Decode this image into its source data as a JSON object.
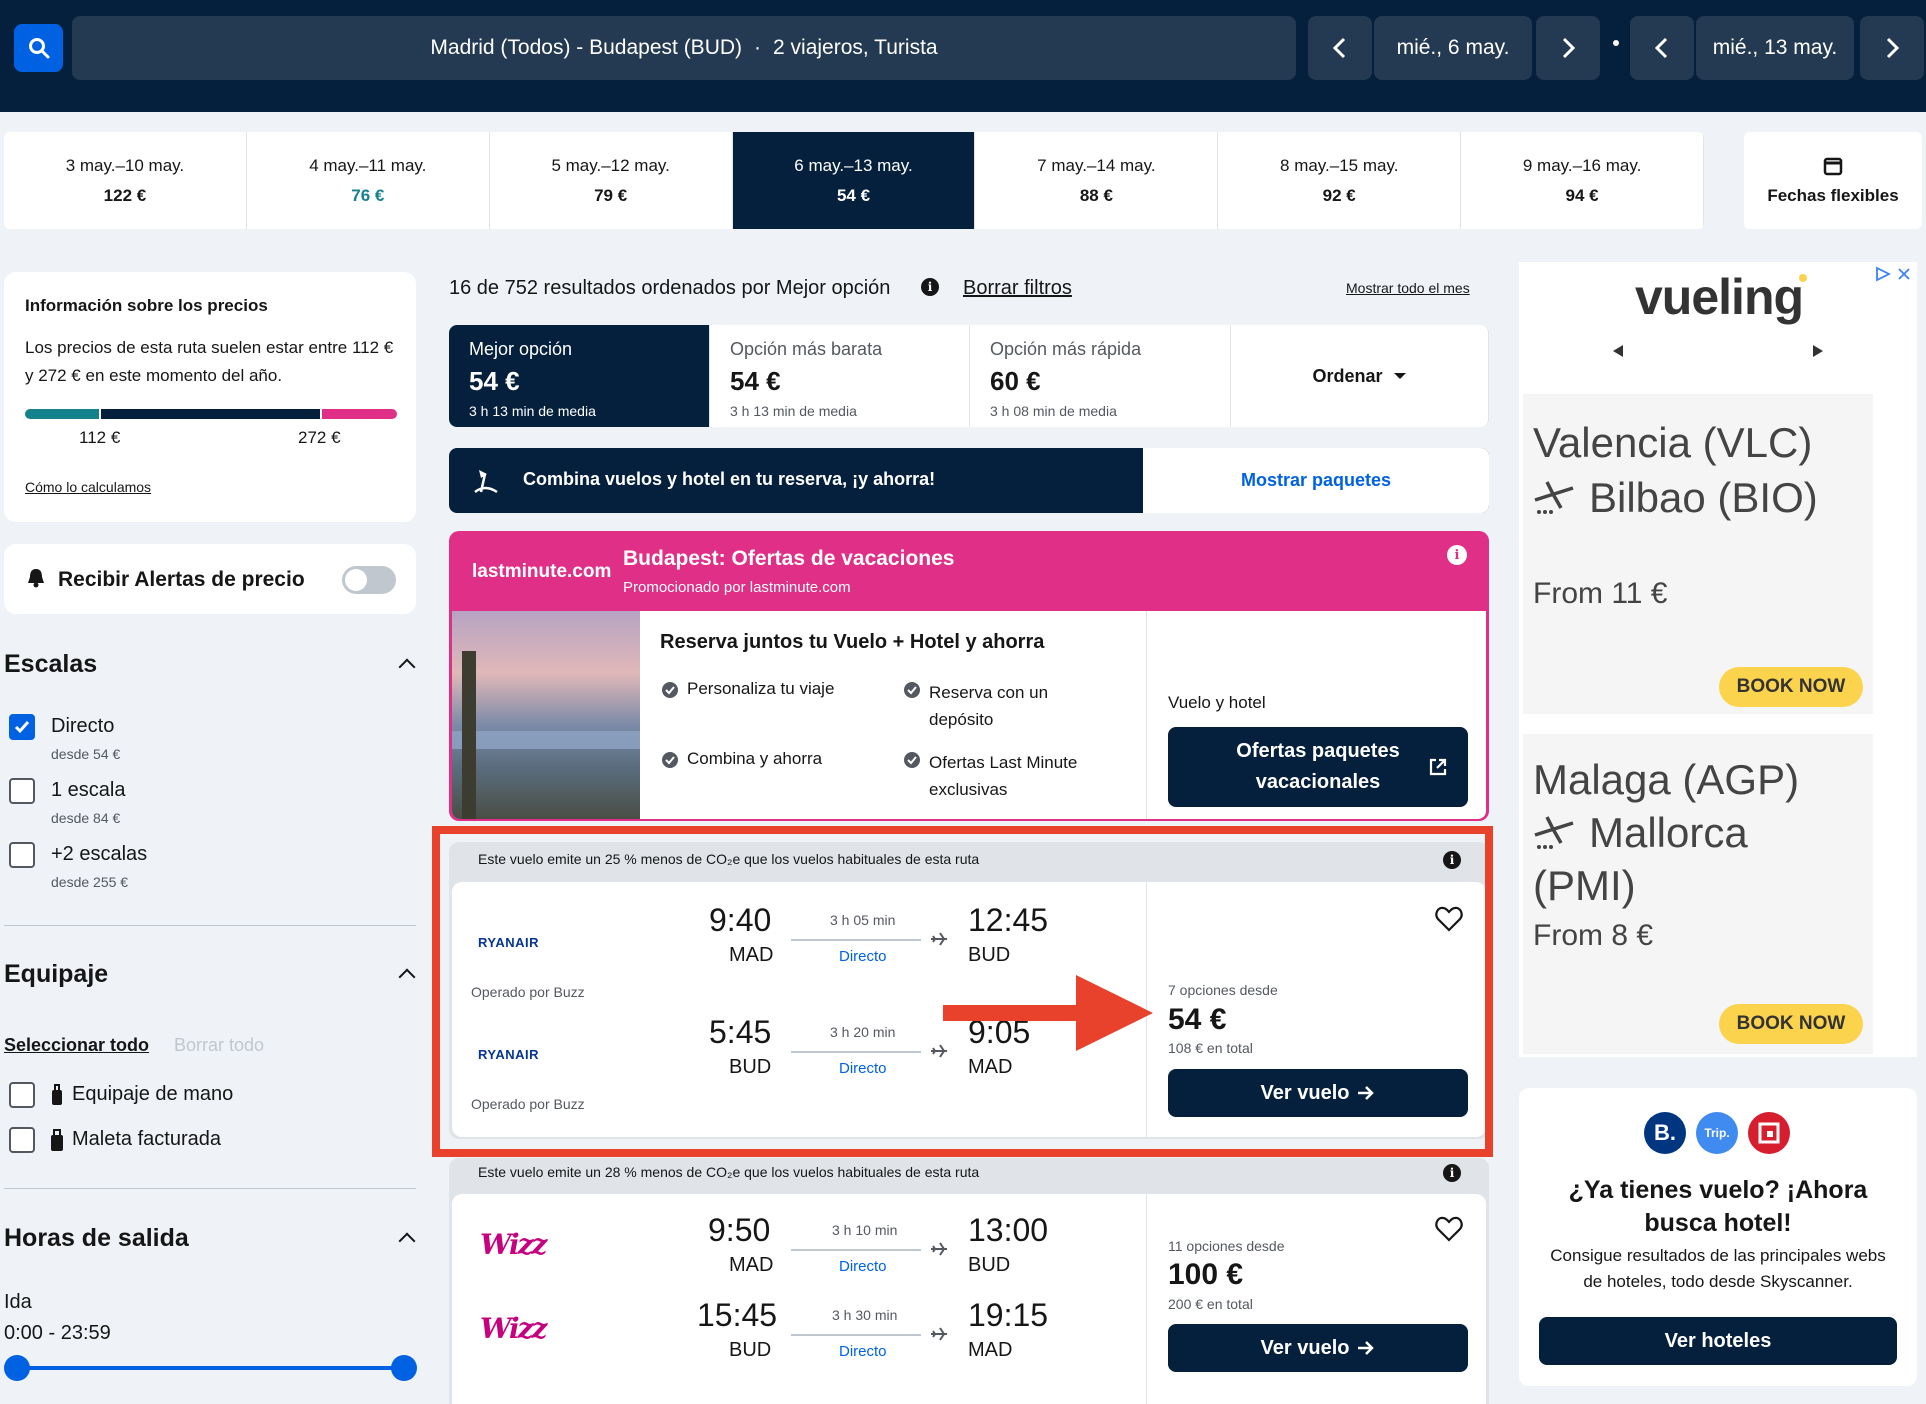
{
  "search": {
    "route": "Madrid (Todos) - Budapest (BUD)",
    "travellers": "2 viajeros, Turista",
    "depart": "mié., 6 may.",
    "return": "mié., 13 may."
  },
  "dates": [
    {
      "range": "3 may.–10 may.",
      "price": "122 €"
    },
    {
      "range": "4 may.–11 may.",
      "price": "76 €",
      "color": "#14828c"
    },
    {
      "range": "5 may.–12 may.",
      "price": "79 €"
    },
    {
      "range": "6 may.–13 may.",
      "price": "54 €",
      "selected": true
    },
    {
      "range": "7 may.–14 may.",
      "price": "88 €"
    },
    {
      "range": "8 may.–15 may.",
      "price": "92 €"
    },
    {
      "range": "9 may.–16 may.",
      "price": "94 €"
    }
  ],
  "flexible": "Fechas flexibles",
  "price_info": {
    "title": "Información sobre los precios",
    "text": "Los precios de esta ruta suelen estar entre 112 € y 272 € en este momento del año.",
    "low": "112 €",
    "high": "272 €",
    "link": "Cómo lo calculamos"
  },
  "alerts": {
    "label": "Recibir Alertas de precio"
  },
  "filters": {
    "stops_title": "Escalas",
    "stops": [
      {
        "label": "Directo",
        "sub": "desde 54 €",
        "checked": true
      },
      {
        "label": "1 escala",
        "sub": "desde 84 €"
      },
      {
        "label": "+2 escalas",
        "sub": "desde 255 €"
      }
    ],
    "bag_title": "Equipaje",
    "select_all": "Seleccionar todo",
    "clear_all": "Borrar todo",
    "bags": [
      {
        "label": "Equipaje de mano"
      },
      {
        "label": "Maleta facturada"
      }
    ],
    "time_title": "Horas de salida",
    "ida": "Ida",
    "range": "0:00 - 23:59"
  },
  "results": {
    "summary": "16 de 752 resultados ordenados por Mejor opción",
    "clear": "Borrar filtros",
    "month": "Mostrar todo el mes"
  },
  "tabs": [
    {
      "title": "Mejor opción",
      "price": "54 €",
      "meta": "3 h 13 min de media"
    },
    {
      "title": "Opción más barata",
      "price": "54 €",
      "meta": "3 h 13 min de media"
    },
    {
      "title": "Opción más rápida",
      "price": "60 €",
      "meta": "3 h 08 min de media"
    }
  ],
  "sort": "Ordenar",
  "combo": {
    "text": "Combina vuelos y hotel en tu reserva, ¡y ahorra!",
    "btn": "Mostrar paquetes"
  },
  "promo": {
    "brand": "lastminute.com",
    "title": "Budapest: Ofertas de vacaciones",
    "sub": "Promocionado por lastminute.com",
    "heading": "Reserva juntos tu Vuelo + Hotel y ahorra",
    "f1": "Personaliza tu viaje",
    "f2": "Reserva con un depósito",
    "f3": "Combina y ahorra",
    "f4": "Ofertas Last Minute exclusivas",
    "label": "Vuelo y hotel",
    "btn": "Ofertas paquetes vacacionales"
  },
  "flights": [
    {
      "co2": "Este vuelo emite un 25 % menos de CO₂e que los vuelos habituales de esta ruta",
      "airline": "RYANAIR",
      "out": {
        "dep": "9:40",
        "from": "MAD",
        "dur": "3 h 05 min",
        "stop": "Directo",
        "arr": "12:45",
        "to": "BUD",
        "op": "Operado por Buzz"
      },
      "ret": {
        "dep": "5:45",
        "from": "BUD",
        "dur": "3 h 20 min",
        "stop": "Directo",
        "arr": "9:05",
        "to": "MAD",
        "op": "Operado por Buzz"
      },
      "options": "7 opciones desde",
      "price": "54 €",
      "total": "108 € en total",
      "btn": "Ver vuelo"
    },
    {
      "co2": "Este vuelo emite un 28 % menos de CO₂e que los vuelos habituales de esta ruta",
      "airline": "Wizz",
      "out": {
        "dep": "9:50",
        "from": "MAD",
        "dur": "3 h 10 min",
        "stop": "Directo",
        "arr": "13:00",
        "to": "BUD"
      },
      "ret": {
        "dep": "15:45",
        "from": "BUD",
        "dur": "3 h 30 min",
        "stop": "Directo",
        "arr": "19:15",
        "to": "MAD"
      },
      "options": "11 opciones desde",
      "price": "100 €",
      "total": "200 € en total",
      "btn": "Ver vuelo"
    }
  ],
  "ads": {
    "brand": "vueling",
    "a1": {
      "route1": "Valencia (VLC)",
      "route2": "Bilbao (BIO)",
      "price": "From 11 €",
      "btn": "BOOK NOW"
    },
    "a2": {
      "route1": "Malaga (AGP)",
      "route2": "Mallorca",
      "route3": "(PMI)",
      "price": "From 8 €",
      "btn": "BOOK NOW"
    }
  },
  "hotel": {
    "b": "B.",
    "trip": "Trip.",
    "title": "¿Ya tienes vuelo? ¡Ahora busca hotel!",
    "text": "Consigue resultados de las principales webs de hoteles, todo desde Skyscanner.",
    "btn": "Ver hoteles"
  },
  "colors": {
    "navy": "#05203c",
    "blue": "#0062e3",
    "promo": "#e02f86",
    "highlight": "#e8412c"
  }
}
